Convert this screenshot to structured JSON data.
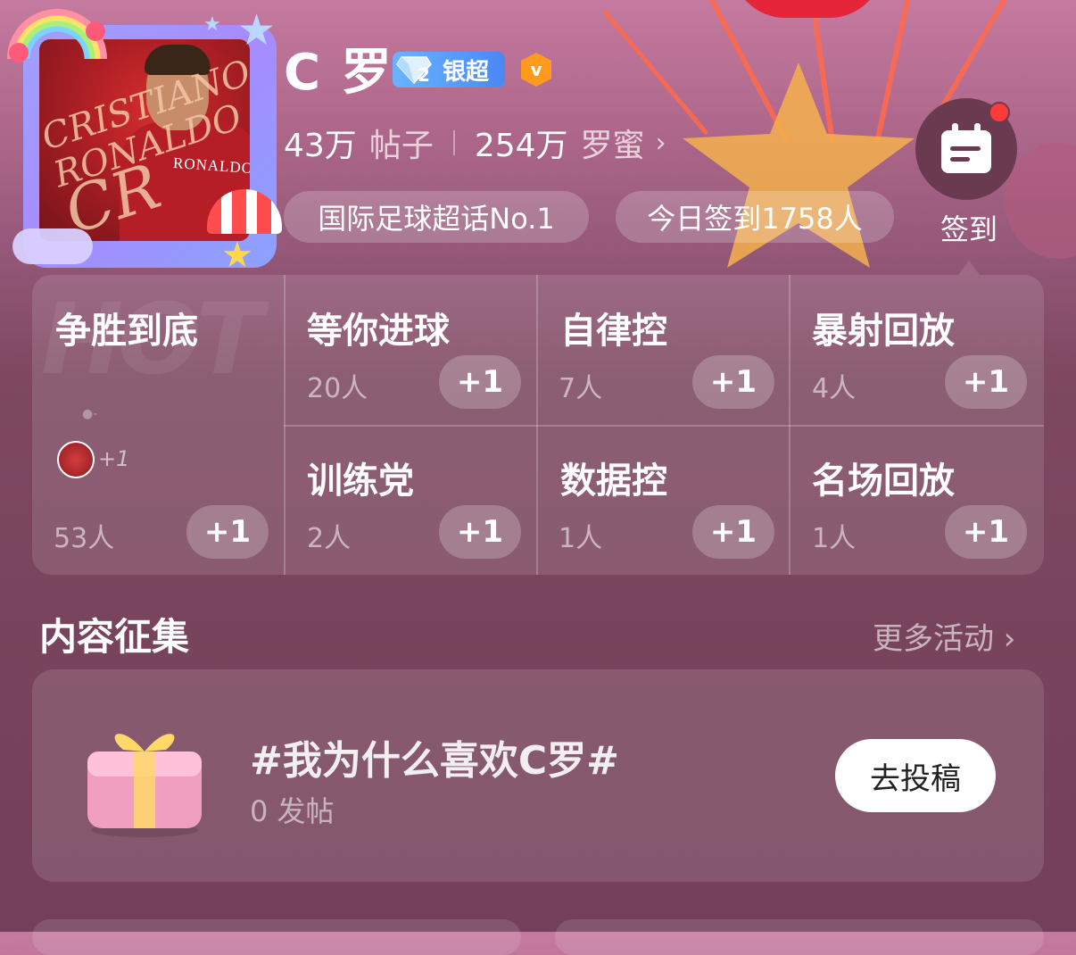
{
  "header": {
    "title": "C 罗",
    "level_badge": {
      "level": "2",
      "label": "银超"
    },
    "verified_icon": "verified-v-icon",
    "stats": [
      {
        "value": "43万",
        "label": "帖子"
      },
      {
        "value": "254万",
        "label": "罗蜜",
        "chevron": "›"
      }
    ],
    "tags": [
      "国际足球超话No.1",
      "今日签到1758人"
    ],
    "checkin": {
      "label": "签到",
      "icon": "calendar-icon"
    },
    "avatar": {
      "script_text": [
        "CRISTIANO",
        "RONALDO",
        "CR"
      ],
      "shirt_text": "RONALDO"
    }
  },
  "groups": [
    {
      "name": "争胜到底",
      "count": "53人",
      "join": "+1",
      "member_more": "+1"
    },
    {
      "name": "等你进球",
      "count": "20人",
      "join": "+1"
    },
    {
      "name": "自律控",
      "count": "7人",
      "join": "+1"
    },
    {
      "name": "暴射回放",
      "count": "4人",
      "join": "+1"
    },
    {
      "name": "训练党",
      "count": "2人",
      "join": "+1"
    },
    {
      "name": "数据控",
      "count": "1人",
      "join": "+1"
    },
    {
      "name": "名场回放",
      "count": "1人",
      "join": "+1"
    }
  ],
  "content_section": {
    "title": "内容征集",
    "more": "更多活动 ›",
    "topic": "#我为什么喜欢C罗#",
    "posts": "0 发帖",
    "submit": "去投稿"
  },
  "colors": {
    "accent_blue": "#4a88f3",
    "verified_orange": "#ff9a1f",
    "badge_red": "#ff3a3a"
  }
}
